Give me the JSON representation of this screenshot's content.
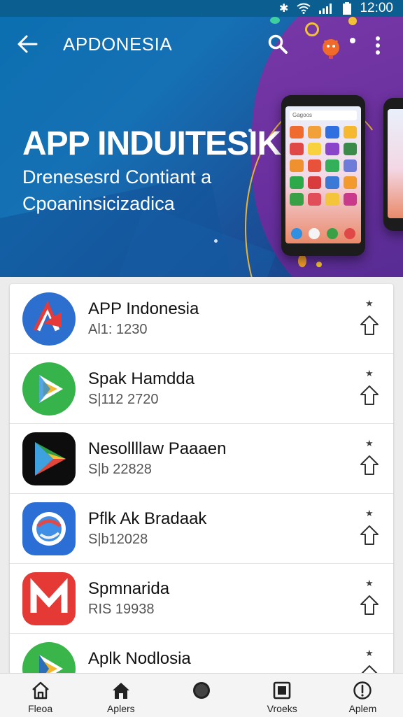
{
  "status_bar": {
    "time": "12:00"
  },
  "app_bar": {
    "title": "APDONESIA"
  },
  "hero": {
    "title": "APP INDUITESIK",
    "subtitle_line1": "Drenesesrd Contiant a",
    "subtitle_line2": "Cpoaninsicizadica"
  },
  "phone": {
    "search_text": "Gagoos"
  },
  "apps": [
    {
      "name": "APP Indonesia",
      "meta": "Al1: 1230"
    },
    {
      "name": "Spak Hamdda",
      "meta": "S|112 2720"
    },
    {
      "name": "Nesollllaw Paaaen",
      "meta": "S|b 22828"
    },
    {
      "name": "Pflk Ak Bradaak",
      "meta": "S|b12028"
    },
    {
      "name": "Spmnarida",
      "meta": "RIS 19938"
    },
    {
      "name": "Aplk Nodlosia",
      "meta": ""
    }
  ],
  "bottom_nav": [
    {
      "label": "Fleoa",
      "icon": "home-outline-icon"
    },
    {
      "label": "Aplers",
      "icon": "home-filled-icon"
    },
    {
      "label": "",
      "icon": "circle-icon"
    },
    {
      "label": "Vroeks",
      "icon": "square-icon"
    },
    {
      "label": "Aplem",
      "icon": "info-circle-icon"
    }
  ],
  "colors": {
    "status_bar": "#0a5f90",
    "hero_blue": "#1670b4",
    "hero_purple": "#6a2f9e",
    "accent_gold": "#e7b43a"
  }
}
